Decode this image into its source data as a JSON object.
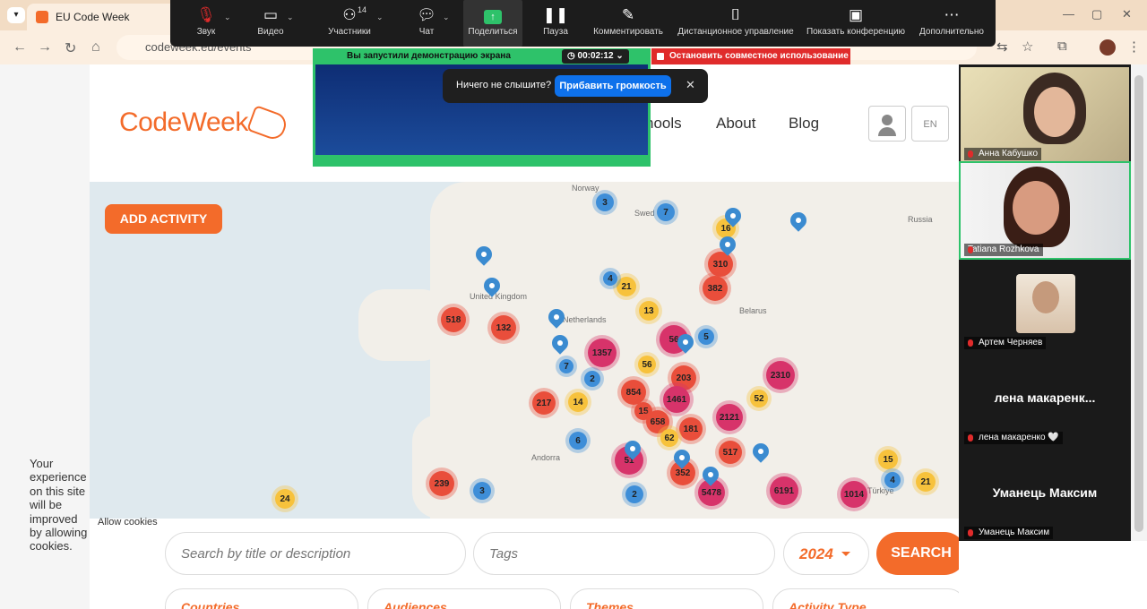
{
  "browser": {
    "tab_title": "EU Code Week",
    "url": "codeweek.eu/events"
  },
  "zoom": {
    "toolbar": [
      {
        "id": "audio",
        "label": "Звук",
        "icon": "mic-muted-icon"
      },
      {
        "id": "video",
        "label": "Видео",
        "icon": "camera-icon"
      },
      {
        "id": "participants",
        "label": "Участники",
        "icon": "people-icon",
        "count": "14"
      },
      {
        "id": "chat",
        "label": "Чат",
        "icon": "chat-icon"
      },
      {
        "id": "share",
        "label": "Поделиться",
        "icon": "share-screen-icon"
      },
      {
        "id": "pause",
        "label": "Пауза",
        "icon": "pause-icon"
      },
      {
        "id": "annotate",
        "label": "Комментировать",
        "icon": "pencil-icon"
      },
      {
        "id": "remote",
        "label": "Дистанционное управление",
        "icon": "mouse-icon"
      },
      {
        "id": "show-meeting",
        "label": "Показать конференцию",
        "icon": "window-icon"
      },
      {
        "id": "more",
        "label": "Дополнительно",
        "icon": "more-icon"
      }
    ],
    "share_status": "Вы запустили демонстрацию экрана",
    "timer": "00:02:12",
    "stop_share": "Остановить совместное использование",
    "hear_prompt": "Ничего не слышите?",
    "volume_button": "Прибавить громкость"
  },
  "site": {
    "logo": "CodeWeek",
    "menu": [
      "hools",
      "About",
      "Blog"
    ],
    "lang": "EN",
    "add_activity": "ADD ACTIVITY",
    "allow_cookies": "Allow cookies",
    "cookie_note": "Your experience on this site will be improved by allowing cookies.",
    "search_placeholder": "Search by title or description",
    "tags_placeholder": "Tags",
    "year": "2024",
    "search_button": "SEARCH",
    "filters": [
      "Countries",
      "Audiences",
      "Themes",
      "Activity Type"
    ]
  },
  "map": {
    "labels": [
      "Norway",
      "Swed",
      "Russia",
      "United Kingdom",
      "Netherlands",
      "Belarus",
      "Andorra",
      "Türkiye"
    ],
    "clusters": [
      {
        "value": "3",
        "color": "blue"
      },
      {
        "value": "7",
        "color": "blue"
      },
      {
        "value": "16",
        "color": "yellow"
      },
      {
        "value": "310",
        "color": "red"
      },
      {
        "value": "21",
        "color": "yellow"
      },
      {
        "value": "4",
        "color": "blue"
      },
      {
        "value": "382",
        "color": "red"
      },
      {
        "value": "13",
        "color": "yellow"
      },
      {
        "value": "518",
        "color": "red"
      },
      {
        "value": "132",
        "color": "red"
      },
      {
        "value": "1357",
        "color": "pink"
      },
      {
        "value": "56",
        "color": "pink"
      },
      {
        "value": "5",
        "color": "blue"
      },
      {
        "value": "56",
        "color": "yellow"
      },
      {
        "value": "7",
        "color": "blue"
      },
      {
        "value": "2",
        "color": "blue"
      },
      {
        "value": "203",
        "color": "red"
      },
      {
        "value": "2310",
        "color": "pink"
      },
      {
        "value": "854",
        "color": "red"
      },
      {
        "value": "1461",
        "color": "pink"
      },
      {
        "value": "217",
        "color": "red"
      },
      {
        "value": "14",
        "color": "yellow"
      },
      {
        "value": "52",
        "color": "yellow"
      },
      {
        "value": "2121",
        "color": "pink"
      },
      {
        "value": "15",
        "color": "red"
      },
      {
        "value": "658",
        "color": "red"
      },
      {
        "value": "181",
        "color": "red"
      },
      {
        "value": "62",
        "color": "yellow"
      },
      {
        "value": "6",
        "color": "blue"
      },
      {
        "value": "51",
        "color": "pink"
      },
      {
        "value": "517",
        "color": "red"
      },
      {
        "value": "352",
        "color": "red"
      },
      {
        "value": "5478",
        "color": "pink"
      },
      {
        "value": "6191",
        "color": "pink"
      },
      {
        "value": "1014",
        "color": "pink"
      },
      {
        "value": "15",
        "color": "yellow"
      },
      {
        "value": "4",
        "color": "blue"
      },
      {
        "value": "21",
        "color": "yellow"
      },
      {
        "value": "239",
        "color": "red"
      },
      {
        "value": "3",
        "color": "blue"
      },
      {
        "value": "2",
        "color": "blue"
      },
      {
        "value": "24",
        "color": "yellow"
      }
    ]
  },
  "participants": [
    {
      "name": "Анна Кабушко",
      "type": "video"
    },
    {
      "name": "Tatiana Rozhkova",
      "type": "video"
    },
    {
      "name": "Артем Черняев",
      "type": "avatar"
    },
    {
      "name": "лена макаренко 🤍",
      "display": "лена  макаренк...",
      "type": "name"
    },
    {
      "name": "Уманець Максим",
      "display": "Уманець Максим",
      "type": "name"
    }
  ],
  "colors": {
    "brand": "#f36b2a",
    "share_green": "#2ec26a",
    "stop_red": "#e02b2b",
    "zoom_blue": "#0e71eb"
  }
}
